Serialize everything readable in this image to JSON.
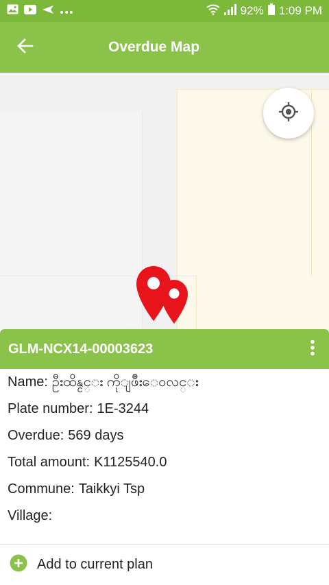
{
  "status_bar": {
    "battery": "92%",
    "time": "1:09 PM",
    "icons": [
      "gallery-icon",
      "youtube-icon",
      "send-icon",
      "more-dots-icon",
      "wifi-icon",
      "signal-icon",
      "battery-icon"
    ]
  },
  "app_bar": {
    "title": "Overdue Map",
    "back_icon": "arrow-left-icon"
  },
  "map": {
    "locate_icon": "my-location-icon",
    "pins": 2,
    "pin_color": "#e8141c"
  },
  "info_card": {
    "id": "GLM-NCX14-00003623",
    "menu_icon": "more-vert-icon",
    "fields": [
      {
        "label": "Name:",
        "value": "ဦးထိန္ငင္း ကိုျဖိဳးေဝလင္း"
      },
      {
        "label": "Plate number:",
        "value": "1E-3244"
      },
      {
        "label": "Overdue:",
        "value": "569 days"
      },
      {
        "label": "Total amount:",
        "value": "K1125540.0"
      },
      {
        "label": "Commune:",
        "value": "Taikkyi Tsp"
      },
      {
        "label": "Village:",
        "value": ""
      }
    ]
  },
  "action": {
    "add_label": "Add to current plan",
    "add_icon": "add-circle-icon"
  },
  "colors": {
    "primary": "#8bc34a",
    "status_bar": "#7cb83a",
    "pin": "#e8141c"
  }
}
